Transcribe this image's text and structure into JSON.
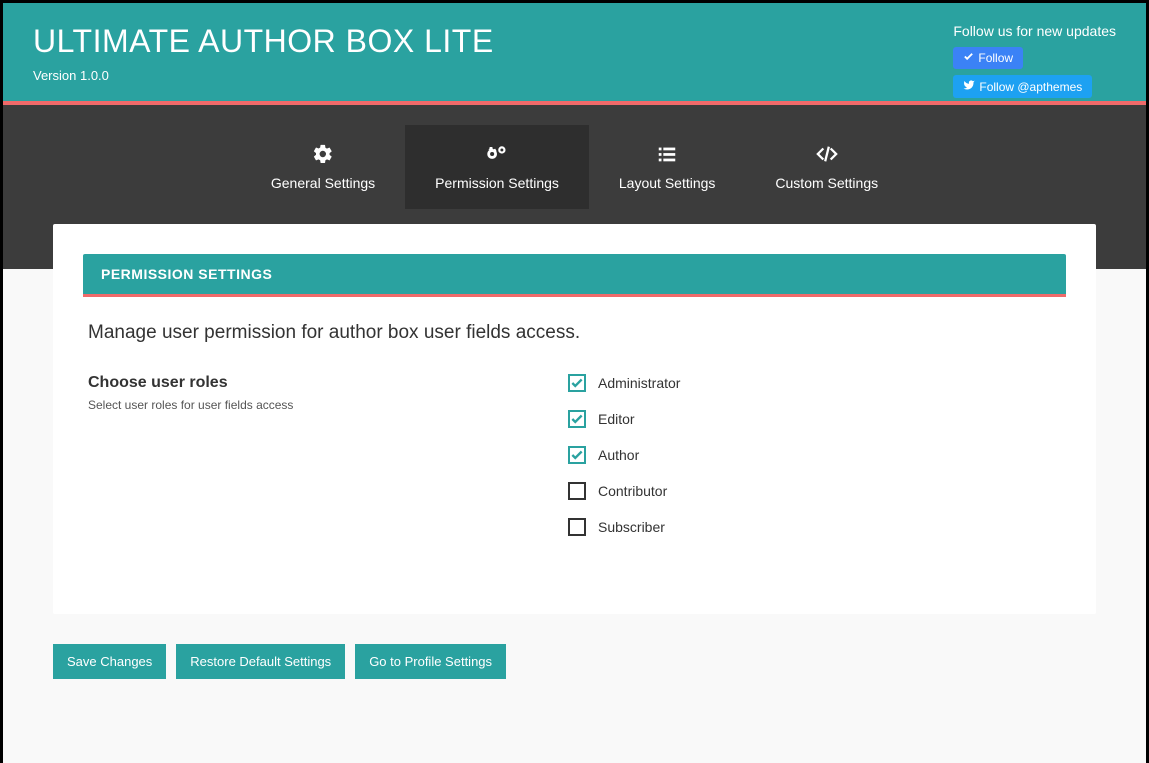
{
  "header": {
    "title": "ULTIMATE AUTHOR BOX LITE",
    "version": "Version 1.0.0",
    "follow_prompt": "Follow us for new updates",
    "follow_btn": "Follow",
    "twitter_btn": "Follow @apthemes"
  },
  "tabs": {
    "general": "General Settings",
    "permission": "Permission Settings",
    "layout": "Layout Settings",
    "custom": "Custom Settings",
    "active": "permission"
  },
  "panel": {
    "head": "PERMISSION SETTINGS",
    "title": "Manage user permission for author box user fields access.",
    "choose_label": "Choose user roles",
    "choose_sub": "Select user roles for user fields access"
  },
  "roles": [
    {
      "label": "Administrator",
      "checked": true
    },
    {
      "label": "Editor",
      "checked": true
    },
    {
      "label": "Author",
      "checked": true
    },
    {
      "label": "Contributor",
      "checked": false
    },
    {
      "label": "Subscriber",
      "checked": false
    }
  ],
  "buttons": {
    "save": "Save Changes",
    "restore": "Restore Default Settings",
    "profile": "Go to Profile Settings"
  }
}
